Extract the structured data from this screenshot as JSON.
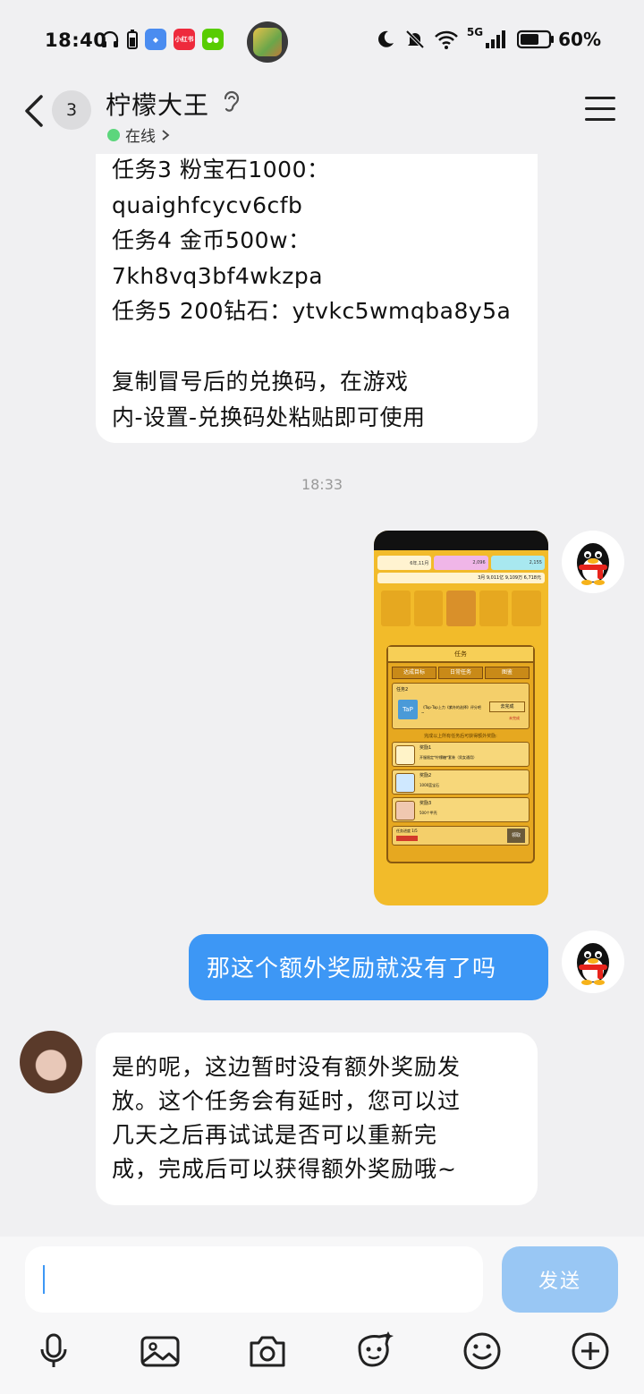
{
  "status_bar": {
    "time": "18:40",
    "battery": "60%",
    "network": "5G",
    "app_icons": [
      "headphone-icon",
      "battery-small-icon",
      "browser-icon",
      "xiaohongshu-icon",
      "duolingo-icon"
    ],
    "xiaohongshu_label": "小红书"
  },
  "header": {
    "back_count": "3",
    "title": "柠檬大王",
    "status": "在线"
  },
  "messages": {
    "incoming_1": {
      "lines": [
        "任务3 粉宝石1000：",
        "quaighfcycv6cfb",
        "任务4 金币500w：",
        "7kh8vq3bf4wkzpa",
        "任务5 200钻石：ytvkc5wmqba8y5a",
        "",
        "复制冒号后的兑换码，在游戏",
        "内-设置-兑换码处粘贴即可使用"
      ]
    },
    "timestamp": "18:33",
    "outgoing_image": {
      "game_title": "任务",
      "tabs": [
        "达成目标",
        "日常任务",
        "图鉴"
      ],
      "task_label": "任务2",
      "task_text": "《Tap·Tap上力《紫舟的选择》评分吧~",
      "claim_label": "去完成",
      "status_label": "未完成",
      "bonus_header": "完成以上所有任务后可获得额外奖励:",
      "rewards": [
        {
          "name": "奖励1",
          "desc": "开服限定*柠檬糖*套装（男女通用）"
        },
        {
          "name": "奖励2",
          "desc": "1000蓝宝石"
        },
        {
          "name": "奖励3",
          "desc": "500个甲壳"
        }
      ],
      "progress_label": "任务进度 1/5",
      "claim_button": "领取",
      "top_bar": [
        "6年,11月",
        "2,096",
        "2,155"
      ],
      "top_bar_2": "3月 9,011亿 9,109万 6,718元",
      "tap_label": "TaP"
    },
    "outgoing_text": "那这个额外奖励就没有了吗",
    "incoming_2": {
      "lines": [
        "是的呢，这边暂时没有额外奖励发",
        "放。这个任务会有延时，您可以过",
        "几天之后再试试是否可以重新完",
        "成，完成后可以获得额外奖励哦~"
      ]
    }
  },
  "input": {
    "value": "",
    "send_label": "发送"
  },
  "toolbar": {
    "tools": [
      "microphone-icon",
      "image-icon",
      "camera-icon",
      "sticker-icon",
      "emoji-icon",
      "plus-icon"
    ]
  },
  "colors": {
    "accent": "#3d97f5",
    "send_disabled": "#99c7f4",
    "online": "#5cd67c",
    "background": "#f0f0f2"
  }
}
